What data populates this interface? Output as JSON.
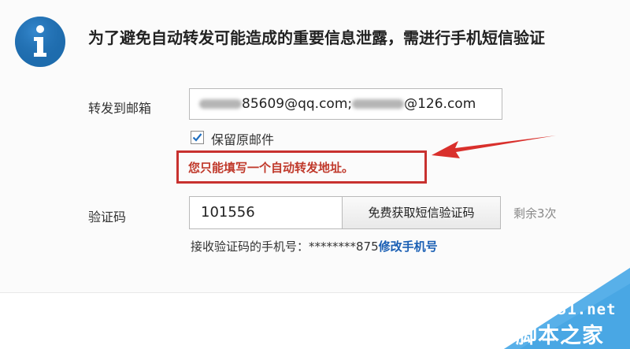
{
  "message": {
    "headline": "为了避免自动转发可能造成的重要信息泄露，需进行手机短信验证",
    "icon": "info-icon"
  },
  "form": {
    "email_label": "转发到邮箱",
    "email_value_part1": "85609@qq.com;",
    "email_value_part2": "@126.com",
    "keep_original_label": "保留原邮件",
    "keep_original_checked": true,
    "warning": "您只能填写一个自动转发地址。",
    "code_label": "验证码",
    "code_value": "101556",
    "sms_button_label": "免费获取短信验证码",
    "remaining": "剩余3次",
    "phone_prefix": "接收验证码的手机号：********875",
    "change_phone_link": "修改手机号"
  },
  "watermark": {
    "site": "jb51.net",
    "name": "脚本之家"
  },
  "colors": {
    "warning_border": "#c8312f",
    "arrow": "#d9302c",
    "info_icon": "#1f70b3",
    "link": "#1a5fb4",
    "watermark_bg": "#49a7e4"
  }
}
